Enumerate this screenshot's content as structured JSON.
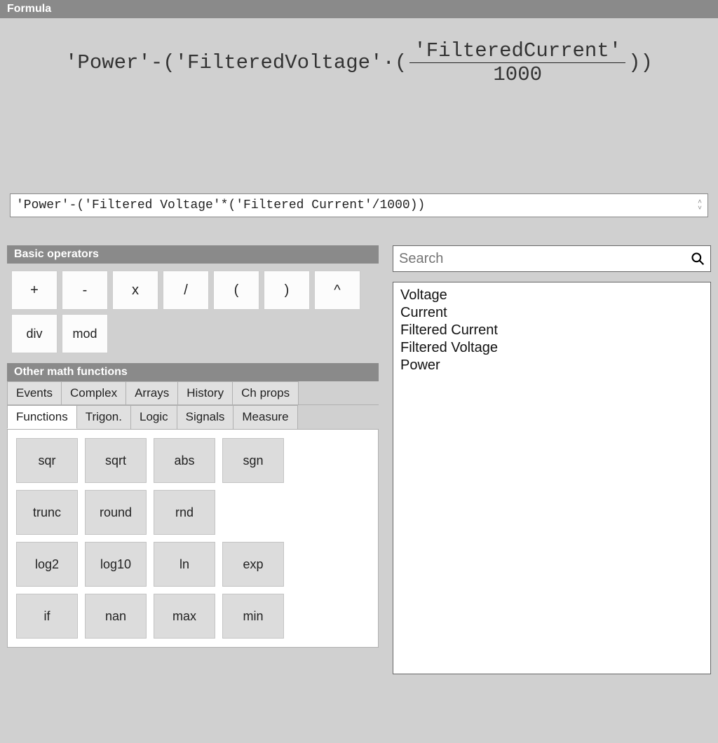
{
  "header": {
    "title": "Formula"
  },
  "formula_render": {
    "prefix": "'Power'-('FilteredVoltage'·(",
    "fraction": {
      "numerator": "'FilteredCurrent'",
      "denominator": "1000"
    },
    "suffix": "))"
  },
  "formula_input": {
    "value": "'Power'-('Filtered Voltage'*('Filtered Current'/1000))"
  },
  "operators": {
    "header": "Basic operators",
    "row1": [
      "+",
      "-",
      "x",
      "/"
    ],
    "row2": [
      "(",
      ")",
      "^",
      "div",
      "mod"
    ]
  },
  "other": {
    "header": "Other math functions",
    "tabs_row1": [
      "Events",
      "Complex",
      "Arrays",
      "History",
      "Ch props"
    ],
    "tabs_row2": [
      "Functions",
      "Trigon.",
      "Logic",
      "Signals",
      "Measure"
    ],
    "active_tab": "Functions",
    "functions": [
      "sqr",
      "sqrt",
      "abs",
      "sgn",
      "trunc",
      "round",
      "rnd",
      "",
      "log2",
      "log10",
      "ln",
      "exp",
      "if",
      "nan",
      "max",
      "min"
    ]
  },
  "search": {
    "placeholder": "Search"
  },
  "variables": [
    "Voltage",
    "Current",
    "Filtered Current",
    "Filtered Voltage",
    "Power"
  ]
}
